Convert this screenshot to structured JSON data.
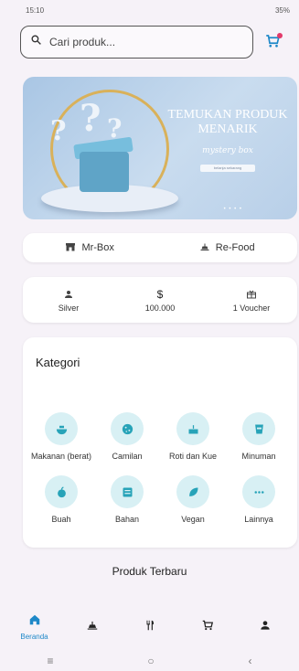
{
  "status_bar": {
    "time": "15:10",
    "right": "35%"
  },
  "search": {
    "placeholder": "Cari produk..."
  },
  "banner": {
    "title": "TEMUKAN PRODUK MENARIK",
    "subtitle": "mystery box",
    "button": "belanja sekarang",
    "dots": "• • • •"
  },
  "modes": [
    {
      "label": "Mr-Box",
      "icon": "store-icon"
    },
    {
      "label": "Re-Food",
      "icon": "food-icon"
    }
  ],
  "stats": [
    {
      "value": "Silver",
      "icon": "person-icon"
    },
    {
      "value": "100.000",
      "symbol": "$",
      "icon": "dollar-icon"
    },
    {
      "value": "1 Voucher",
      "icon": "voucher-icon"
    }
  ],
  "categories": {
    "title": "Kategori",
    "items": [
      {
        "label": "Makanan (berat)",
        "icon": "bowl-icon"
      },
      {
        "label": "Camilan",
        "icon": "cookie-icon"
      },
      {
        "label": "Roti dan Kue",
        "icon": "cake-icon"
      },
      {
        "label": "Minuman",
        "icon": "cup-icon"
      },
      {
        "label": "Buah",
        "icon": "apple-icon"
      },
      {
        "label": "Bahan",
        "icon": "ingredients-icon"
      },
      {
        "label": "Vegan",
        "icon": "leaf-icon"
      },
      {
        "label": "Lainnya",
        "icon": "more-icon"
      }
    ]
  },
  "sections": {
    "new_products": "Produk Terbaru"
  },
  "bottom_nav": {
    "items": [
      {
        "label": "Beranda",
        "icon": "home-icon",
        "active": true
      },
      {
        "label": "",
        "icon": "store-icon"
      },
      {
        "label": "",
        "icon": "restaurant-icon"
      },
      {
        "label": "",
        "icon": "cart-icon"
      },
      {
        "label": "",
        "icon": "person-icon"
      }
    ]
  },
  "system_nav": {
    "menu": "≡",
    "home": "○",
    "back": "‹"
  },
  "colors": {
    "accent": "#1e88c8",
    "category_bg": "#d8f0f4",
    "category_icon": "#27a3b8",
    "badge": "#e23a6a"
  }
}
